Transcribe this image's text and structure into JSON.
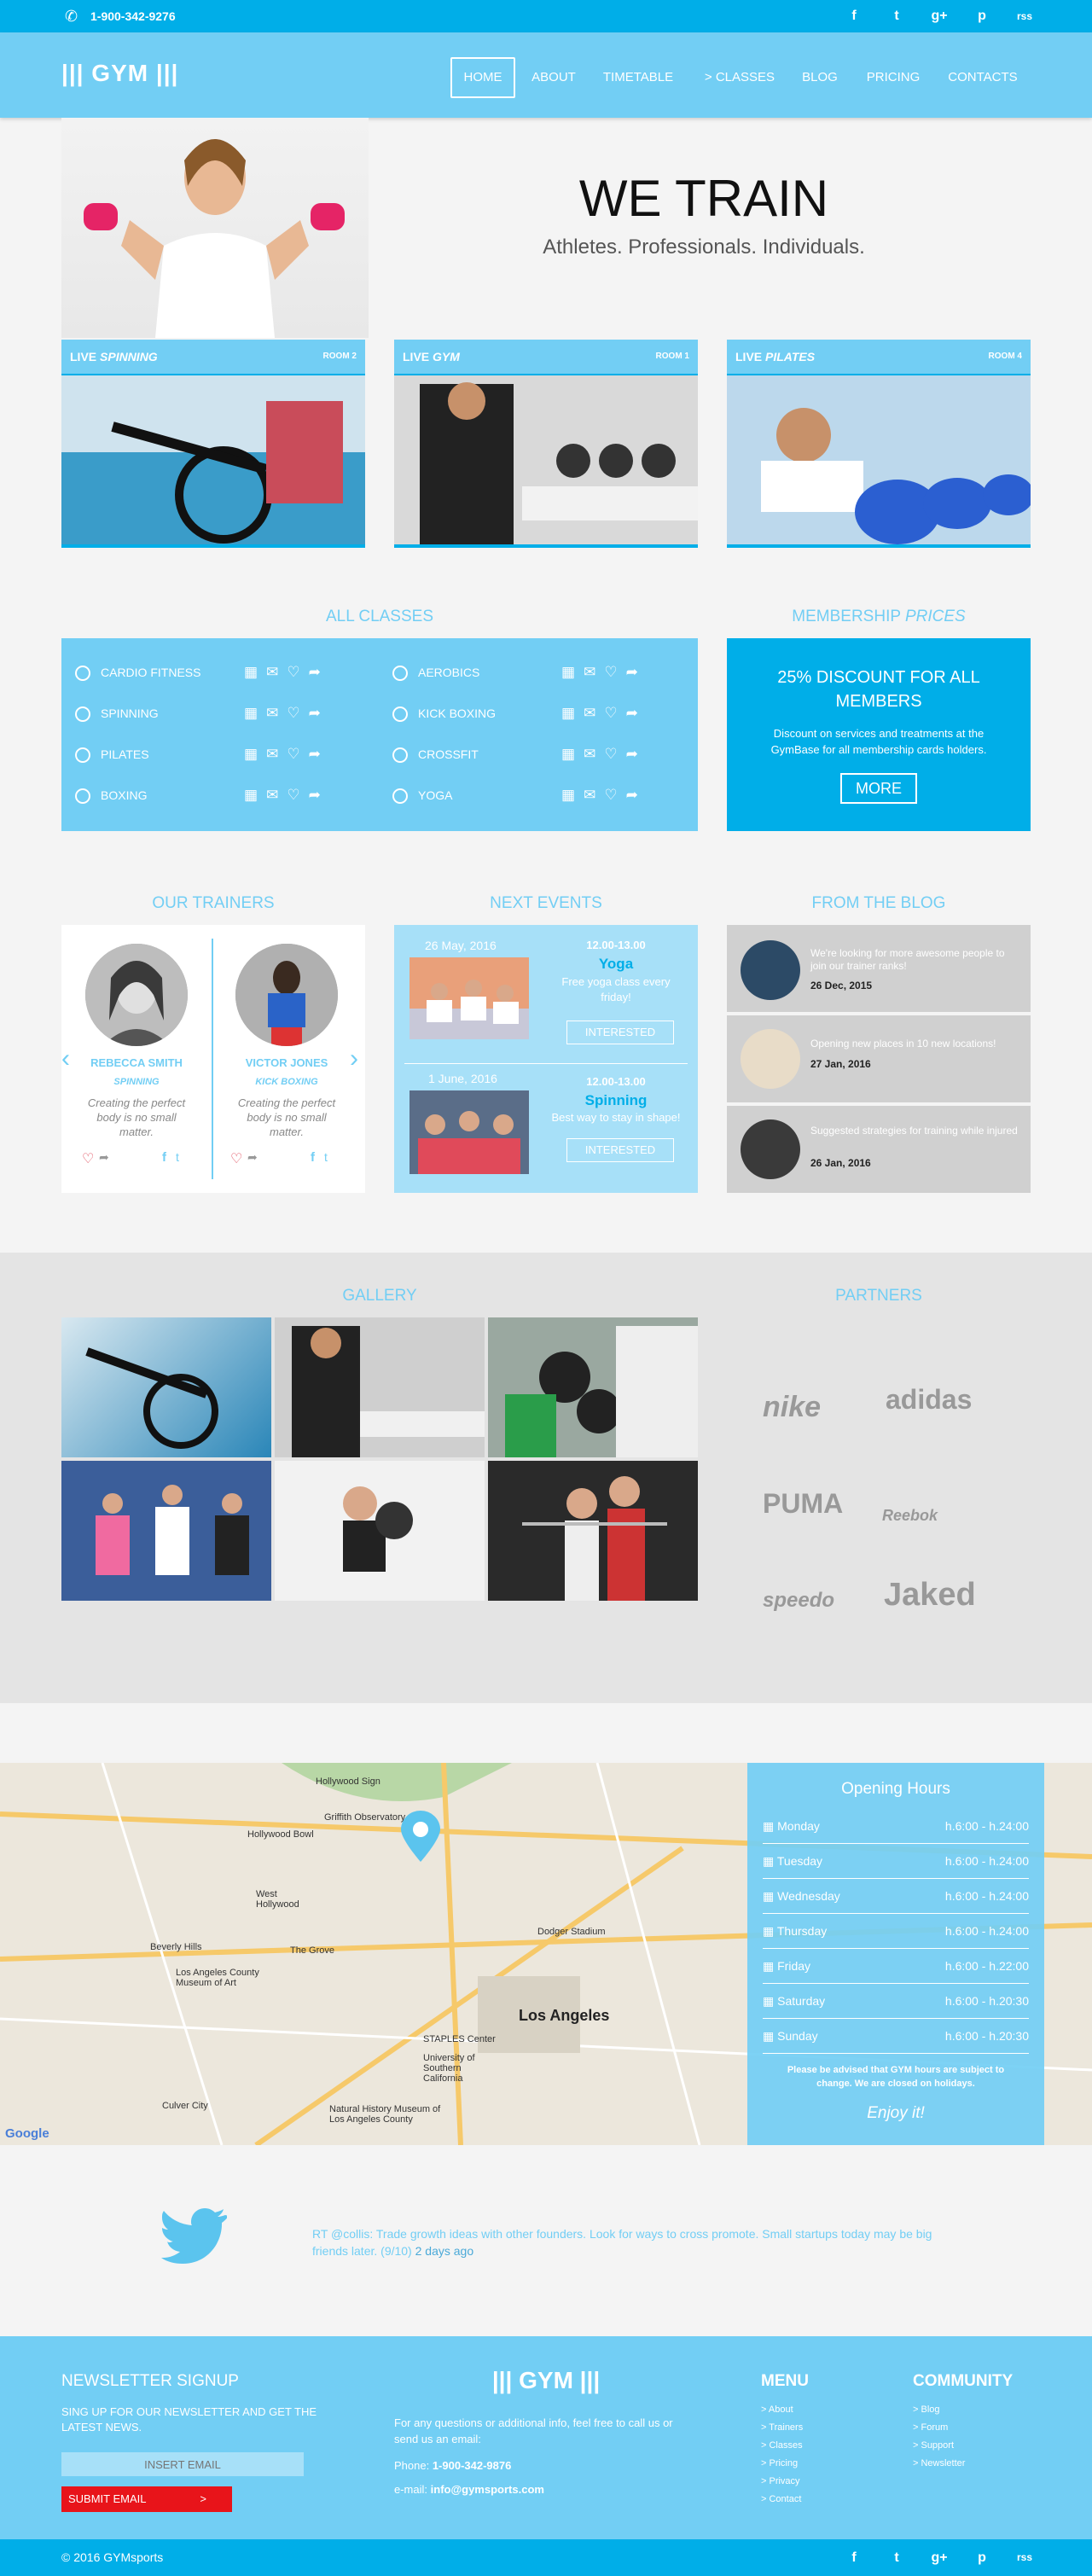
{
  "topbar": {
    "phone": "1-900-342-9276",
    "social": [
      "f",
      "t",
      "g+",
      "p",
      "rss"
    ]
  },
  "logo": "GYM",
  "nav": [
    "HOME",
    "ABOUT",
    "TIMETABLE",
    "> CLASSES",
    "BLOG",
    "PRICING",
    "CONTACTS"
  ],
  "hero": {
    "title": "WE TRAIN",
    "subtitle": "Athletes. Professionals. Individuals."
  },
  "cards": [
    {
      "live": "LIVE",
      "name": "SPINNING",
      "room": "ROOM 2"
    },
    {
      "live": "LIVE",
      "name": "GYM",
      "room": "ROOM 1"
    },
    {
      "live": "LIVE",
      "name": "PILATES",
      "room": "ROOM 4"
    }
  ],
  "classes_title": "ALL CLASSES",
  "classes": [
    "CARDIO FITNESS",
    "AEROBICS",
    "SPINNING",
    "KICK BOXING",
    "PILATES",
    "CROSSFIT",
    "BOXING",
    "YOGA"
  ],
  "membership": {
    "title": "MEMBERSHIP",
    "title_em": "PRICES",
    "headline": "25% DISCOUNT FOR ALL MEMBERS",
    "text": "Discount on services and treatments at the GymBase for all membership cards holders.",
    "button": "MORE"
  },
  "trainers_title": "OUR TRAINERS",
  "trainers": [
    {
      "name": "REBECCA SMITH",
      "role": "SPINNING",
      "quote": "Creating the perfect body is no small matter."
    },
    {
      "name": "VICTOR JONES",
      "role": "KICK BOXING",
      "quote": "Creating the perfect body is no small matter."
    }
  ],
  "events_title": "NEXT EVENTS",
  "events": [
    {
      "date": "26 May, 2016",
      "time": "12.00-13.00",
      "name": "Yoga",
      "desc": "Free yoga class every friday!",
      "button": "INTERESTED"
    },
    {
      "date": "1 June, 2016",
      "time": "12.00-13.00",
      "name": "Spinning",
      "desc": "Best way to stay in shape!",
      "button": "INTERESTED"
    }
  ],
  "blog_title": "FROM THE BLOG",
  "blog": [
    {
      "text": "We're looking for more awesome people to join our trainer ranks!",
      "date": "26 Dec, 2015"
    },
    {
      "text": "Opening new places in 10 new locations!",
      "date": "27 Jan, 2016"
    },
    {
      "text": "Suggested strategies for training while injured",
      "date": "26 Jan, 2016"
    }
  ],
  "gallery_title": "GALLERY",
  "partners_title": "PARTNERS",
  "partners": [
    "nike",
    "adidas",
    "PUMA",
    "Reebok",
    "speedo",
    "Jaked"
  ],
  "map_labels": [
    "Hollywood Sign",
    "Griffith Observatory",
    "Hollywood Bowl",
    "West Hollywood",
    "Beverly Hills",
    "The Grove",
    "Los Angeles County Museum of Art",
    "Dodger Stadium",
    "Los Angeles",
    "STAPLES Center",
    "University of Southern California",
    "Natural History Museum of Los Angeles County",
    "Culver City",
    "Google"
  ],
  "hours": {
    "title": "Opening Hours",
    "rows": [
      {
        "day": "Monday",
        "time": "h.6:00 - h.24:00"
      },
      {
        "day": "Tuesday",
        "time": "h.6:00 - h.24:00"
      },
      {
        "day": "Wednesday",
        "time": "h.6:00 - h.24:00"
      },
      {
        "day": "Thursday",
        "time": "h.6:00 - h.24:00"
      },
      {
        "day": "Friday",
        "time": "h.6:00 - h.22:00"
      },
      {
        "day": "Saturday",
        "time": "h.6:00 - h.20:30"
      },
      {
        "day": "Sunday",
        "time": "h.6:00 - h.20:30"
      }
    ],
    "note": "Please be advised that GYM hours are subject to change. We are closed on holidays.",
    "enjoy": "Enjoy it!"
  },
  "tweet": {
    "text": "RT @collis: Trade growth ideas with other founders. Look for ways to cross promote. Small startups today may be big friends later. (9/10)",
    "ago": "2 days ago"
  },
  "footer": {
    "newsletter_title": "NEWSLETTER SIGNUP",
    "newsletter_text": "SING UP FOR OUR NEWSLETTER AND GET THE LATEST NEWS.",
    "email_placeholder": "INSERT EMAIL",
    "submit": "SUBMIT EMAIL",
    "logo": "GYM",
    "contact_text": "For any questions or additional info, feel free to call us or send us an email:",
    "phone_label": "Phone:",
    "phone": "1-900-342-9876",
    "email_label": "e-mail:",
    "email": "info@gymsports.com",
    "menu_title": "MENU",
    "menu": [
      "> About",
      "> Trainers",
      "> Classes",
      "> Pricing",
      "> Privacy",
      "> Contact"
    ],
    "community_title": "COMMUNITY",
    "community": [
      "> Blog",
      "> Forum",
      "> Support",
      "> Newsletter"
    ]
  },
  "bottom": {
    "copyright": "© 2016 GYMsports"
  }
}
